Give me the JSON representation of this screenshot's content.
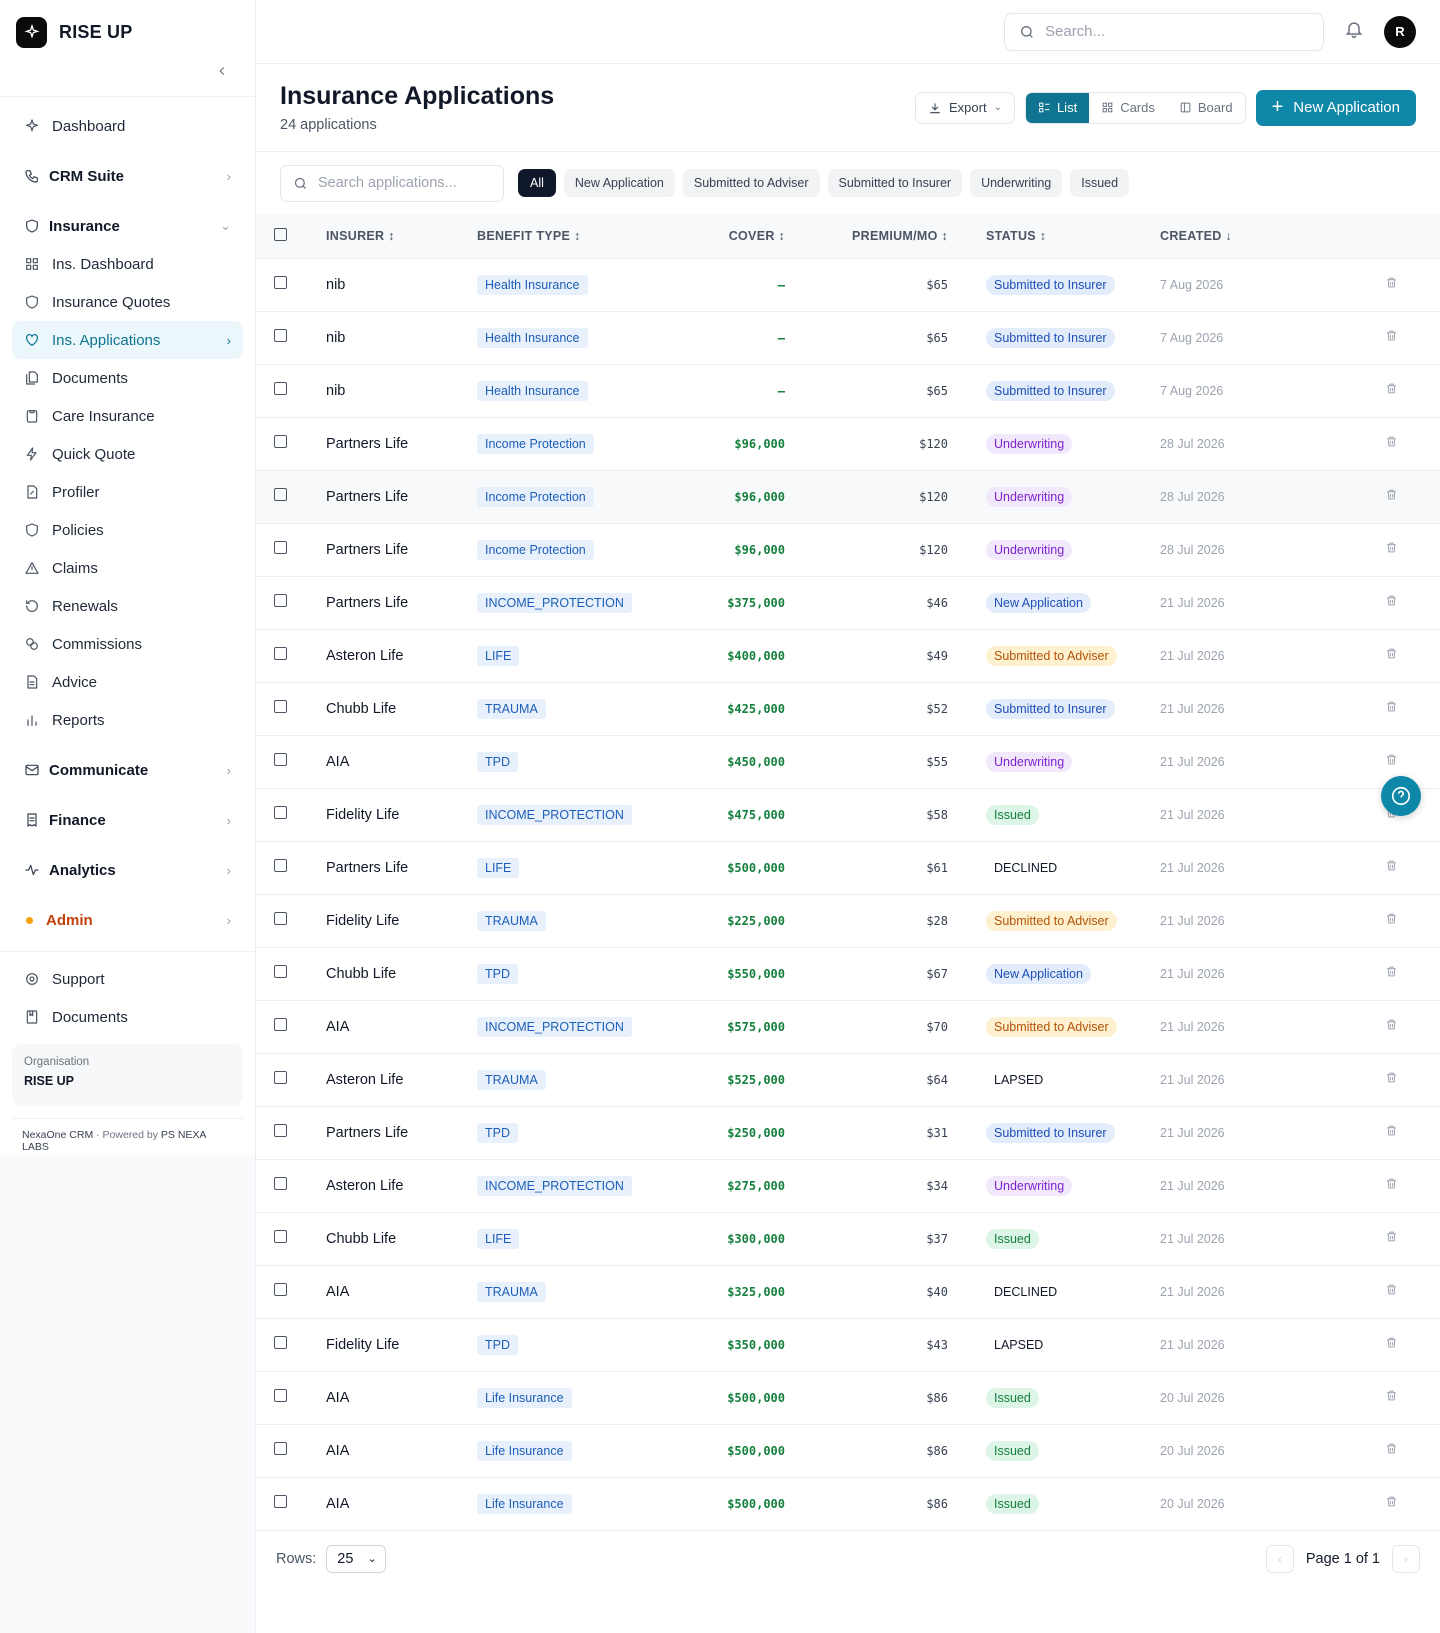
{
  "brand": {
    "name": "RISE UP"
  },
  "sidebar": {
    "top": [
      {
        "label": "Dashboard"
      }
    ],
    "groups": {
      "crm": "CRM Suite",
      "insurance": "Insurance",
      "communicate": "Communicate",
      "finance": "Finance",
      "analytics": "Analytics",
      "admin": "Admin"
    },
    "insurance_items": [
      {
        "label": "Ins. Dashboard"
      },
      {
        "label": "Insurance Quotes"
      },
      {
        "label": "Ins. Applications"
      },
      {
        "label": "Documents"
      },
      {
        "label": "Care Insurance"
      },
      {
        "label": "Quick Quote"
      },
      {
        "label": "Profiler"
      },
      {
        "label": "Policies"
      },
      {
        "label": "Claims"
      },
      {
        "label": "Renewals"
      },
      {
        "label": "Commissions"
      },
      {
        "label": "Advice"
      },
      {
        "label": "Reports"
      }
    ],
    "bottom": [
      {
        "label": "Support"
      },
      {
        "label": "Documents"
      }
    ],
    "org_label": "Organisation",
    "org_value": "RISE UP",
    "powered_prefix": "NexaOne CRM",
    "powered_mid": "· Powered by",
    "powered_brand": "PS NEXA LABS"
  },
  "topbar": {
    "search_placeholder": "Search...",
    "avatar": "R"
  },
  "page": {
    "title": "Insurance Applications",
    "subtitle": "24 applications",
    "export": "Export",
    "views": [
      "List",
      "Cards",
      "Board"
    ],
    "new_button": "New Application"
  },
  "filters": {
    "search_placeholder": "Search applications...",
    "chips": [
      "All",
      "New Application",
      "Submitted to Adviser",
      "Submitted to Insurer",
      "Underwriting",
      "Issued"
    ]
  },
  "table": {
    "headers": {
      "insurer": "INSURER",
      "benefit": "BENEFIT TYPE",
      "cover": "COVER",
      "premium": "PREMIUM/MO",
      "status": "STATUS",
      "created": "CREATED"
    },
    "rows": [
      {
        "insurer": "nib",
        "benefit": "Health Insurance",
        "cover": "–",
        "premium": "$65",
        "status": "Submitted to Insurer",
        "created": "7 Aug 2026"
      },
      {
        "insurer": "nib",
        "benefit": "Health Insurance",
        "cover": "–",
        "premium": "$65",
        "status": "Submitted to Insurer",
        "created": "7 Aug 2026"
      },
      {
        "insurer": "nib",
        "benefit": "Health Insurance",
        "cover": "–",
        "premium": "$65",
        "status": "Submitted to Insurer",
        "created": "7 Aug 2026"
      },
      {
        "insurer": "Partners Life",
        "benefit": "Income Protection",
        "cover": "$96,000",
        "premium": "$120",
        "status": "Underwriting",
        "created": "28 Jul 2026"
      },
      {
        "insurer": "Partners Life",
        "benefit": "Income Protection",
        "cover": "$96,000",
        "premium": "$120",
        "status": "Underwriting",
        "created": "28 Jul 2026"
      },
      {
        "insurer": "Partners Life",
        "benefit": "Income Protection",
        "cover": "$96,000",
        "premium": "$120",
        "status": "Underwriting",
        "created": "28 Jul 2026"
      },
      {
        "insurer": "Partners Life",
        "benefit": "INCOME_PROTECTION",
        "cover": "$375,000",
        "premium": "$46",
        "status": "New Application",
        "created": "21 Jul 2026"
      },
      {
        "insurer": "Asteron Life",
        "benefit": "LIFE",
        "cover": "$400,000",
        "premium": "$49",
        "status": "Submitted to Adviser",
        "created": "21 Jul 2026"
      },
      {
        "insurer": "Chubb Life",
        "benefit": "TRAUMA",
        "cover": "$425,000",
        "premium": "$52",
        "status": "Submitted to Insurer",
        "created": "21 Jul 2026"
      },
      {
        "insurer": "AIA",
        "benefit": "TPD",
        "cover": "$450,000",
        "premium": "$55",
        "status": "Underwriting",
        "created": "21 Jul 2026"
      },
      {
        "insurer": "Fidelity Life",
        "benefit": "INCOME_PROTECTION",
        "cover": "$475,000",
        "premium": "$58",
        "status": "Issued",
        "created": "21 Jul 2026"
      },
      {
        "insurer": "Partners Life",
        "benefit": "LIFE",
        "cover": "$500,000",
        "premium": "$61",
        "status": "DECLINED",
        "created": "21 Jul 2026"
      },
      {
        "insurer": "Fidelity Life",
        "benefit": "TRAUMA",
        "cover": "$225,000",
        "premium": "$28",
        "status": "Submitted to Adviser",
        "created": "21 Jul 2026"
      },
      {
        "insurer": "Chubb Life",
        "benefit": "TPD",
        "cover": "$550,000",
        "premium": "$67",
        "status": "New Application",
        "created": "21 Jul 2026"
      },
      {
        "insurer": "AIA",
        "benefit": "INCOME_PROTECTION",
        "cover": "$575,000",
        "premium": "$70",
        "status": "Submitted to Adviser",
        "created": "21 Jul 2026"
      },
      {
        "insurer": "Asteron Life",
        "benefit": "TRAUMA",
        "cover": "$525,000",
        "premium": "$64",
        "status": "LAPSED",
        "created": "21 Jul 2026"
      },
      {
        "insurer": "Partners Life",
        "benefit": "TPD",
        "cover": "$250,000",
        "premium": "$31",
        "status": "Submitted to Insurer",
        "created": "21 Jul 2026"
      },
      {
        "insurer": "Asteron Life",
        "benefit": "INCOME_PROTECTION",
        "cover": "$275,000",
        "premium": "$34",
        "status": "Underwriting",
        "created": "21 Jul 2026"
      },
      {
        "insurer": "Chubb Life",
        "benefit": "LIFE",
        "cover": "$300,000",
        "premium": "$37",
        "status": "Issued",
        "created": "21 Jul 2026"
      },
      {
        "insurer": "AIA",
        "benefit": "TRAUMA",
        "cover": "$325,000",
        "premium": "$40",
        "status": "DECLINED",
        "created": "21 Jul 2026"
      },
      {
        "insurer": "Fidelity Life",
        "benefit": "TPD",
        "cover": "$350,000",
        "premium": "$43",
        "status": "LAPSED",
        "created": "21 Jul 2026"
      },
      {
        "insurer": "AIA",
        "benefit": "Life Insurance",
        "cover": "$500,000",
        "premium": "$86",
        "status": "Issued",
        "created": "20 Jul 2026"
      },
      {
        "insurer": "AIA",
        "benefit": "Life Insurance",
        "cover": "$500,000",
        "premium": "$86",
        "status": "Issued",
        "created": "20 Jul 2026"
      },
      {
        "insurer": "AIA",
        "benefit": "Life Insurance",
        "cover": "$500,000",
        "premium": "$86",
        "status": "Issued",
        "created": "20 Jul 2026"
      }
    ]
  },
  "footer": {
    "rows_label": "Rows:",
    "rows_value": "25",
    "page_text": "Page 1 of 1"
  },
  "colors": {
    "accent": "#0e87a8",
    "active_nav": "#0e7490"
  }
}
